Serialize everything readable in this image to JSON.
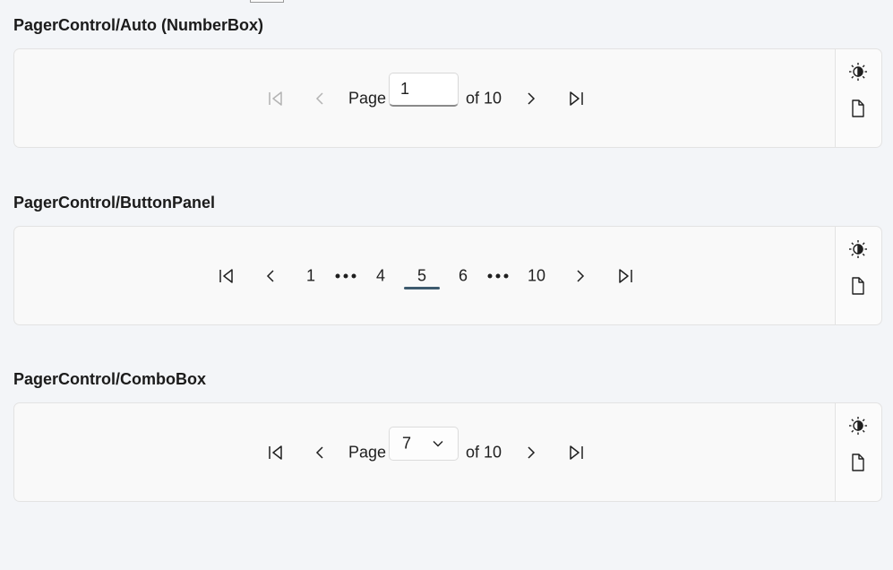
{
  "sections": [
    {
      "title": "PagerControl/Auto (NumberBox)",
      "page_label": "Page",
      "of_label": "of 10",
      "input_value": "1"
    },
    {
      "title": "PagerControl/ButtonPanel",
      "pages": [
        "1",
        "4",
        "5",
        "6",
        "10"
      ],
      "selected_page": "5"
    },
    {
      "title": "PagerControl/ComboBox",
      "page_label": "Page",
      "of_label": "of 10",
      "combo_value": "7"
    }
  ],
  "icons": {
    "first": "first-page-icon",
    "prev": "previous-page-icon",
    "next": "next-page-icon",
    "last": "last-page-icon",
    "theme": "theme-toggle-icon",
    "source": "document-icon",
    "more": "ellipsis-icon",
    "dropdown": "chevron-down-icon"
  },
  "colors": {
    "background": "#f3f5f8",
    "card": "#f9f9f9",
    "selected_indicator": "#3d5a6e",
    "disabled_icon": "#b3b3b3"
  }
}
